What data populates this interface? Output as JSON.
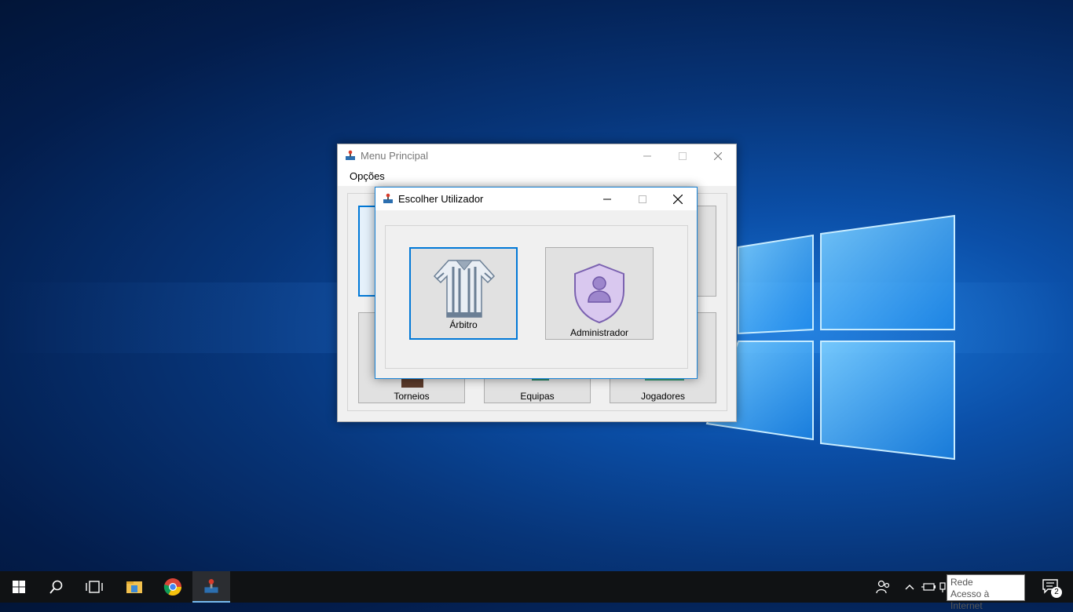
{
  "main_window": {
    "title": "Menu Principal",
    "menu": [
      "Opções"
    ],
    "tiles": [
      {
        "label": "Torneios"
      },
      {
        "label": "Equipas"
      },
      {
        "label": "Jogadores"
      }
    ]
  },
  "dialog": {
    "title": "Escolher Utilizador",
    "options": [
      {
        "label": "Árbitro",
        "icon": "referee-shirt-icon",
        "selected": true
      },
      {
        "label": "Administrador",
        "icon": "admin-shield-icon",
        "selected": false
      }
    ]
  },
  "taskbar": {
    "apps": [
      "start-icon",
      "search-icon",
      "task-view-icon",
      "file-explorer-icon",
      "chrome-icon",
      "app-icon"
    ],
    "notification_count": "2"
  },
  "tooltip": {
    "title": "Rede",
    "subtitle": "Acesso à Internet"
  },
  "colors": {
    "accent": "#0078d7",
    "desktop": "#0b4fa8",
    "taskbar": "#101214"
  }
}
